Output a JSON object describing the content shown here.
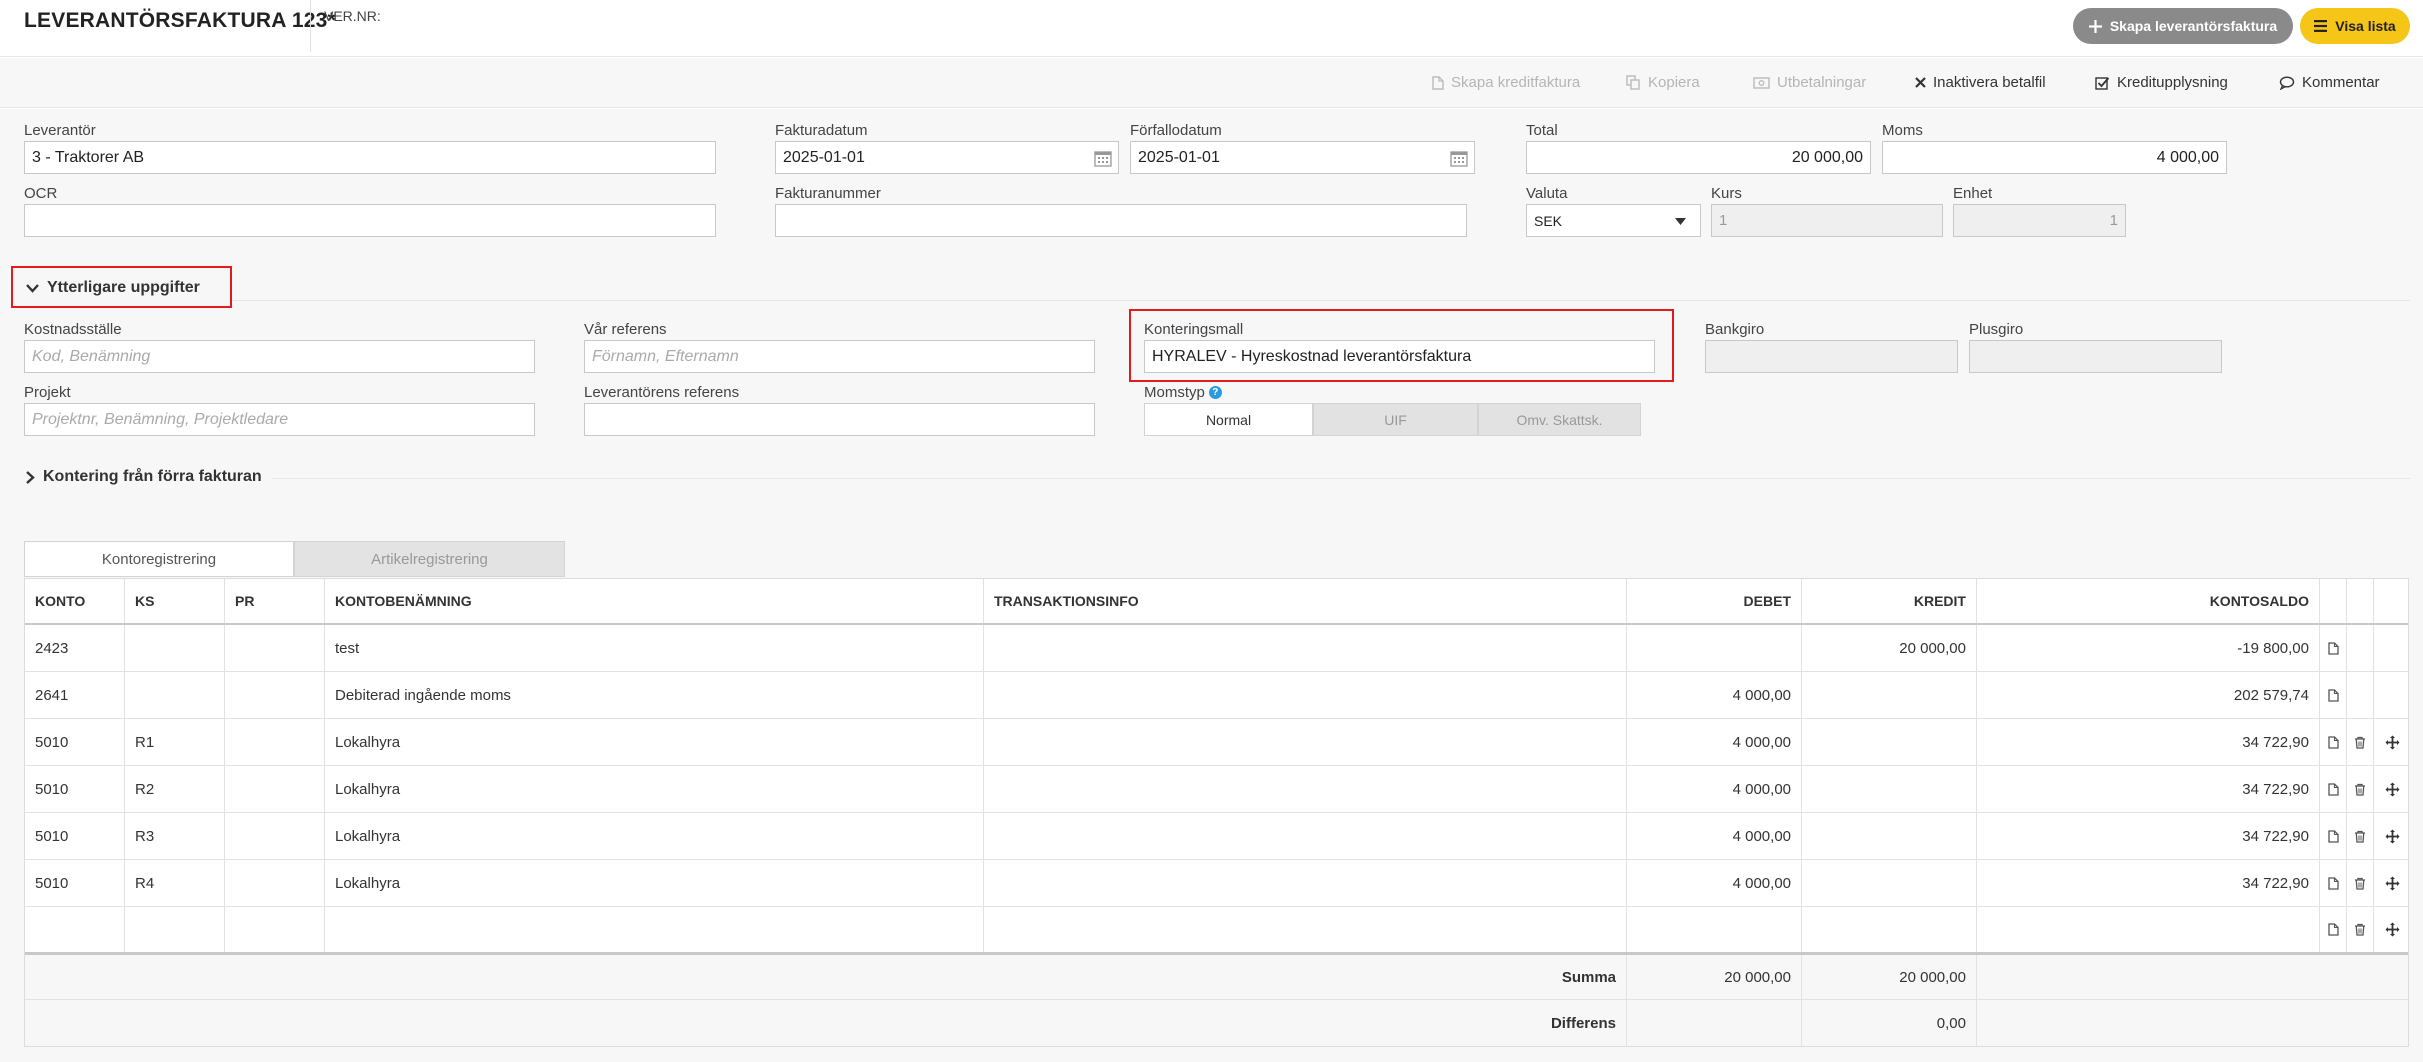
{
  "header": {
    "title": "LEVERANTÖRSFAKTURA 123*",
    "vernr_label": "VER.NR:",
    "create_button": "Skapa leverantörsfaktura",
    "list_button": "Visa lista"
  },
  "toolbar": {
    "items": [
      {
        "label": "Skapa kreditfaktura",
        "icon": "file-icon",
        "enabled": false
      },
      {
        "label": "Kopiera",
        "icon": "copy-icon",
        "enabled": false
      },
      {
        "label": "Utbetalningar",
        "icon": "money-icon",
        "enabled": false
      },
      {
        "label": "Inaktivera betalfil",
        "icon": "close-icon",
        "enabled": true
      },
      {
        "label": "Kreditupplysning",
        "icon": "checkbox-icon",
        "enabled": true
      },
      {
        "label": "Kommentar",
        "icon": "comment-icon",
        "enabled": true
      }
    ]
  },
  "form": {
    "leverantor": {
      "label": "Leverantör",
      "value": "3 - Traktorer AB"
    },
    "fakturadatum": {
      "label": "Fakturadatum",
      "value": "2025-01-01"
    },
    "forfallodatum": {
      "label": "Förfallodatum",
      "value": "2025-01-01"
    },
    "total": {
      "label": "Total",
      "value": "20 000,00"
    },
    "moms": {
      "label": "Moms",
      "value": "4 000,00"
    },
    "ocr": {
      "label": "OCR",
      "value": ""
    },
    "fakturanummer": {
      "label": "Fakturanummer",
      "value": ""
    },
    "valuta": {
      "label": "Valuta",
      "value": "SEK"
    },
    "kurs": {
      "label": "Kurs",
      "value": "1"
    },
    "enhet": {
      "label": "Enhet",
      "value": "1"
    }
  },
  "extra": {
    "section_title": "Ytterligare uppgifter",
    "kostnadsstalle": {
      "label": "Kostnadsställe",
      "placeholder": "Kod, Benämning"
    },
    "var_referens": {
      "label": "Vår referens",
      "placeholder": "Förnamn, Efternamn"
    },
    "konteringsmall": {
      "label": "Konteringsmall",
      "value": "HYRALEV - Hyreskostnad leverantörsfaktura"
    },
    "bankgiro": {
      "label": "Bankgiro",
      "value": ""
    },
    "plusgiro": {
      "label": "Plusgiro",
      "value": ""
    },
    "projekt": {
      "label": "Projekt",
      "placeholder": "Projektnr, Benämning, Projektledare"
    },
    "leverantorens_referens": {
      "label": "Leverantörens referens",
      "value": ""
    },
    "momstyp": {
      "label": "Momstyp",
      "options": [
        "Normal",
        "UIF",
        "Omv. Skattsk."
      ],
      "selected": "Normal"
    }
  },
  "previous_section_title": "Kontering från förra fakturan",
  "tabs": {
    "kontoregistrering": "Kontoregistrering",
    "artikelregistrering": "Artikelregistrering"
  },
  "table": {
    "headers": {
      "konto": "KONTO",
      "ks": "KS",
      "pr": "PR",
      "kontobenamning": "KONTOBENÄMNING",
      "transaktionsinfo": "TRANSAKTIONSINFO",
      "debet": "DEBET",
      "kredit": "KREDIT",
      "kontosaldo": "KONTOSALDO"
    },
    "rows": [
      {
        "konto": "2423",
        "ks": "",
        "pr": "",
        "namn": "test",
        "info": "",
        "debet": "",
        "kredit": "20 000,00",
        "saldo": "-19 800,00",
        "deletable": false
      },
      {
        "konto": "2641",
        "ks": "",
        "pr": "",
        "namn": "Debiterad ingående moms",
        "info": "",
        "debet": "4 000,00",
        "kredit": "",
        "saldo": "202 579,74",
        "deletable": false
      },
      {
        "konto": "5010",
        "ks": "R1",
        "pr": "",
        "namn": "Lokalhyra",
        "info": "",
        "debet": "4 000,00",
        "kredit": "",
        "saldo": "34 722,90",
        "deletable": true
      },
      {
        "konto": "5010",
        "ks": "R2",
        "pr": "",
        "namn": "Lokalhyra",
        "info": "",
        "debet": "4 000,00",
        "kredit": "",
        "saldo": "34 722,90",
        "deletable": true
      },
      {
        "konto": "5010",
        "ks": "R3",
        "pr": "",
        "namn": "Lokalhyra",
        "info": "",
        "debet": "4 000,00",
        "kredit": "",
        "saldo": "34 722,90",
        "deletable": true
      },
      {
        "konto": "5010",
        "ks": "R4",
        "pr": "",
        "namn": "Lokalhyra",
        "info": "",
        "debet": "4 000,00",
        "kredit": "",
        "saldo": "34 722,90",
        "deletable": true
      },
      {
        "konto": "",
        "ks": "",
        "pr": "",
        "namn": "",
        "info": "",
        "debet": "",
        "kredit": "",
        "saldo": "",
        "deletable": true
      }
    ],
    "summa": {
      "label": "Summa",
      "debet": "20 000,00",
      "kredit": "20 000,00"
    },
    "differens": {
      "label": "Differens",
      "debet": "",
      "kredit": "0,00"
    }
  }
}
